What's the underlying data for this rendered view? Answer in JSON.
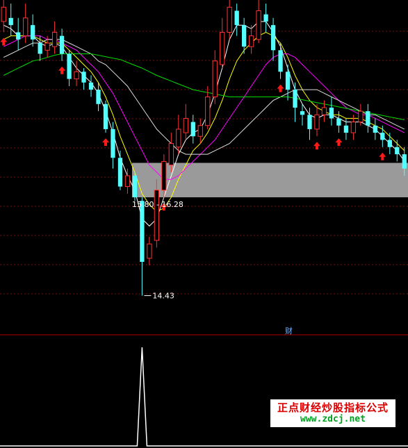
{
  "chart_data": {
    "type": "candlestick",
    "panels": {
      "price": {
        "ylim": [
          14.0,
          18.55
        ],
        "grid": "dotted-horizontal",
        "zone": {
          "low": 15.8,
          "high": 16.28,
          "label": "15.80 - 16.28"
        },
        "low_marker": {
          "value": 14.43,
          "label": "14.43"
        }
      },
      "indicator": {
        "label": "财",
        "ylim": [
          0,
          1
        ],
        "spike_index": 19,
        "spike_value": 1
      }
    },
    "candles": [
      {
        "o": 18.25,
        "c": 18.45,
        "h": 18.6,
        "l": 18.1,
        "up": true
      },
      {
        "o": 18.3,
        "c": 18.2,
        "h": 18.5,
        "l": 18.05,
        "up": false
      },
      {
        "o": 18.1,
        "c": 18.0,
        "h": 18.3,
        "l": 17.85,
        "up": false
      },
      {
        "o": 18.05,
        "c": 18.3,
        "h": 18.5,
        "l": 17.95,
        "up": true
      },
      {
        "o": 18.2,
        "c": 18.0,
        "h": 18.35,
        "l": 17.9,
        "up": false
      },
      {
        "o": 17.95,
        "c": 17.8,
        "h": 18.05,
        "l": 17.7,
        "up": false
      },
      {
        "o": 17.85,
        "c": 17.95,
        "h": 18.05,
        "l": 17.75,
        "up": true
      },
      {
        "o": 17.9,
        "c": 18.1,
        "h": 18.25,
        "l": 17.8,
        "up": true
      },
      {
        "o": 18.05,
        "c": 17.8,
        "h": 18.15,
        "l": 17.7,
        "up": false
      },
      {
        "o": 17.8,
        "c": 17.45,
        "h": 17.85,
        "l": 17.35,
        "up": false
      },
      {
        "o": 17.45,
        "c": 17.55,
        "h": 17.7,
        "l": 17.35,
        "up": true
      },
      {
        "o": 17.55,
        "c": 17.4,
        "h": 17.6,
        "l": 17.3,
        "up": false
      },
      {
        "o": 17.4,
        "c": 17.3,
        "h": 17.5,
        "l": 17.2,
        "up": false
      },
      {
        "o": 17.3,
        "c": 17.1,
        "h": 17.4,
        "l": 17.0,
        "up": false
      },
      {
        "o": 17.1,
        "c": 16.75,
        "h": 17.15,
        "l": 16.7,
        "up": false
      },
      {
        "o": 16.75,
        "c": 16.35,
        "h": 16.85,
        "l": 16.2,
        "up": false
      },
      {
        "o": 16.35,
        "c": 15.95,
        "h": 16.45,
        "l": 15.9,
        "up": false
      },
      {
        "o": 15.95,
        "c": 16.1,
        "h": 16.2,
        "l": 15.85,
        "up": true
      },
      {
        "o": 16.1,
        "c": 15.8,
        "h": 16.15,
        "l": 15.75,
        "up": false
      },
      {
        "o": 15.75,
        "c": 14.9,
        "h": 15.8,
        "l": 14.43,
        "up": false
      },
      {
        "o": 14.95,
        "c": 15.15,
        "h": 15.25,
        "l": 14.85,
        "up": true
      },
      {
        "o": 15.2,
        "c": 15.9,
        "h": 16.05,
        "l": 15.1,
        "up": true
      },
      {
        "o": 15.9,
        "c": 16.3,
        "h": 16.4,
        "l": 15.8,
        "up": true
      },
      {
        "o": 16.25,
        "c": 16.55,
        "h": 16.7,
        "l": 16.15,
        "up": true
      },
      {
        "o": 16.5,
        "c": 16.75,
        "h": 16.95,
        "l": 16.4,
        "up": true
      },
      {
        "o": 16.7,
        "c": 16.9,
        "h": 17.1,
        "l": 16.6,
        "up": true
      },
      {
        "o": 16.85,
        "c": 16.65,
        "h": 16.95,
        "l": 16.55,
        "up": false
      },
      {
        "o": 16.65,
        "c": 16.8,
        "h": 16.9,
        "l": 16.55,
        "up": true
      },
      {
        "o": 16.8,
        "c": 17.2,
        "h": 17.35,
        "l": 16.75,
        "up": true
      },
      {
        "o": 17.2,
        "c": 17.7,
        "h": 17.85,
        "l": 17.1,
        "up": true
      },
      {
        "o": 17.65,
        "c": 18.1,
        "h": 18.3,
        "l": 17.6,
        "up": true
      },
      {
        "o": 18.1,
        "c": 18.45,
        "h": 18.55,
        "l": 18.0,
        "up": true
      },
      {
        "o": 18.4,
        "c": 18.2,
        "h": 18.5,
        "l": 18.05,
        "up": false
      },
      {
        "o": 18.2,
        "c": 17.9,
        "h": 18.3,
        "l": 17.8,
        "up": false
      },
      {
        "o": 17.9,
        "c": 18.05,
        "h": 18.2,
        "l": 17.8,
        "up": true
      },
      {
        "o": 18.0,
        "c": 18.4,
        "h": 18.55,
        "l": 17.95,
        "up": true
      },
      {
        "o": 18.35,
        "c": 18.25,
        "h": 18.5,
        "l": 18.1,
        "up": false
      },
      {
        "o": 18.2,
        "c": 17.85,
        "h": 18.3,
        "l": 17.7,
        "up": false
      },
      {
        "o": 17.85,
        "c": 17.55,
        "h": 17.95,
        "l": 17.45,
        "up": false
      },
      {
        "o": 17.55,
        "c": 17.3,
        "h": 17.65,
        "l": 17.15,
        "up": false
      },
      {
        "o": 17.3,
        "c": 17.05,
        "h": 17.4,
        "l": 16.85,
        "up": false
      },
      {
        "o": 17.0,
        "c": 16.95,
        "h": 17.1,
        "l": 16.8,
        "up": false
      },
      {
        "o": 16.95,
        "c": 16.75,
        "h": 17.05,
        "l": 16.6,
        "up": false
      },
      {
        "o": 16.75,
        "c": 16.95,
        "h": 17.1,
        "l": 16.65,
        "up": true
      },
      {
        "o": 16.95,
        "c": 17.05,
        "h": 17.15,
        "l": 16.85,
        "up": true
      },
      {
        "o": 17.05,
        "c": 16.9,
        "h": 17.2,
        "l": 16.8,
        "up": false
      },
      {
        "o": 16.9,
        "c": 16.8,
        "h": 17.0,
        "l": 16.7,
        "up": false
      },
      {
        "o": 16.8,
        "c": 16.7,
        "h": 16.9,
        "l": 16.6,
        "up": false
      },
      {
        "o": 16.7,
        "c": 16.85,
        "h": 16.95,
        "l": 16.6,
        "up": true
      },
      {
        "o": 16.85,
        "c": 17.0,
        "h": 17.1,
        "l": 16.8,
        "up": true
      },
      {
        "o": 17.0,
        "c": 16.8,
        "h": 17.1,
        "l": 16.7,
        "up": false
      },
      {
        "o": 16.8,
        "c": 16.7,
        "h": 16.9,
        "l": 16.6,
        "up": false
      },
      {
        "o": 16.7,
        "c": 16.6,
        "h": 16.8,
        "l": 16.5,
        "up": false
      },
      {
        "o": 16.6,
        "c": 16.5,
        "h": 16.7,
        "l": 16.4,
        "up": false
      },
      {
        "o": 16.5,
        "c": 16.4,
        "h": 16.6,
        "l": 16.3,
        "up": false
      },
      {
        "o": 16.4,
        "c": 16.2,
        "h": 16.5,
        "l": 16.1,
        "up": false
      }
    ],
    "buy_signals": [
      0,
      8,
      14,
      22,
      38,
      43,
      46,
      52
    ],
    "ma_lines": [
      {
        "color": "#ffffff",
        "values": [
          18.2,
          18.15,
          18.05,
          18.05,
          18.05,
          17.95,
          17.9,
          17.95,
          17.9,
          17.75,
          17.6,
          17.5,
          17.4,
          17.25,
          17.0,
          16.7,
          16.35,
          16.1,
          15.9,
          15.5,
          15.4,
          15.5,
          15.8,
          16.1,
          16.4,
          16.6,
          16.7,
          16.75,
          16.95,
          17.25,
          17.6,
          18.0,
          18.2,
          18.2,
          18.15,
          18.25,
          18.25,
          18.1,
          17.9,
          17.6,
          17.3,
          17.1,
          16.95,
          16.9,
          16.95,
          16.95,
          16.9,
          16.85,
          16.85,
          16.85,
          16.8,
          16.75,
          16.65,
          16.55,
          16.45,
          16.3
        ]
      },
      {
        "color": "#ffff00",
        "values": [
          18.0,
          18.05,
          18.05,
          18.05,
          18.05,
          18.0,
          17.95,
          17.95,
          17.95,
          17.85,
          17.75,
          17.65,
          17.55,
          17.4,
          17.2,
          16.95,
          16.65,
          16.4,
          16.15,
          15.85,
          15.7,
          15.6,
          15.65,
          15.8,
          16.05,
          16.25,
          16.45,
          16.55,
          16.7,
          16.9,
          17.15,
          17.45,
          17.7,
          17.85,
          17.95,
          18.05,
          18.1,
          18.05,
          17.95,
          17.75,
          17.5,
          17.3,
          17.15,
          17.05,
          17.0,
          16.95,
          16.95,
          16.9,
          16.9,
          16.9,
          16.85,
          16.8,
          16.75,
          16.65,
          16.55,
          16.45
        ]
      },
      {
        "color": "#ff00ff",
        "values": [
          17.9,
          17.95,
          18.0,
          18.05,
          18.05,
          18.05,
          18.0,
          18.0,
          17.95,
          17.9,
          17.85,
          17.75,
          17.65,
          17.55,
          17.4,
          17.25,
          17.05,
          16.85,
          16.65,
          16.45,
          16.25,
          16.15,
          16.05,
          16.05,
          16.1,
          16.2,
          16.3,
          16.4,
          16.5,
          16.6,
          16.75,
          16.9,
          17.05,
          17.2,
          17.35,
          17.5,
          17.65,
          17.75,
          17.8,
          17.8,
          17.75,
          17.65,
          17.55,
          17.45,
          17.35,
          17.25,
          17.15,
          17.05,
          17.0,
          16.95,
          16.95,
          16.9,
          16.85,
          16.8,
          16.75,
          16.7
        ]
      },
      {
        "color": "#dcdcdc",
        "values": [
          17.75,
          17.8,
          17.85,
          17.9,
          17.95,
          17.95,
          18.0,
          18.0,
          18.0,
          17.95,
          17.9,
          17.85,
          17.8,
          17.7,
          17.65,
          17.55,
          17.45,
          17.35,
          17.2,
          17.05,
          16.9,
          16.75,
          16.65,
          16.55,
          16.45,
          16.4,
          16.4,
          16.4,
          16.4,
          16.45,
          16.5,
          16.55,
          16.65,
          16.75,
          16.85,
          16.95,
          17.05,
          17.15,
          17.2,
          17.25,
          17.3,
          17.3,
          17.3,
          17.3,
          17.25,
          17.2,
          17.15,
          17.1,
          17.05,
          17.0,
          16.95,
          16.95,
          16.9,
          16.85,
          16.8,
          16.75
        ]
      },
      {
        "color": "#00dd00",
        "values": [
          17.5,
          17.55,
          17.6,
          17.65,
          17.7,
          17.72,
          17.75,
          17.78,
          17.8,
          17.8,
          17.8,
          17.8,
          17.8,
          17.78,
          17.76,
          17.74,
          17.72,
          17.68,
          17.64,
          17.6,
          17.55,
          17.5,
          17.46,
          17.42,
          17.38,
          17.34,
          17.3,
          17.28,
          17.26,
          17.24,
          17.22,
          17.2,
          17.2,
          17.2,
          17.2,
          17.2,
          17.2,
          17.2,
          17.2,
          17.2,
          17.18,
          17.16,
          17.14,
          17.12,
          17.1,
          17.08,
          17.06,
          17.04,
          17.02,
          17.0,
          16.98,
          16.96,
          16.94,
          16.92,
          16.9,
          16.88
        ]
      }
    ]
  },
  "watermark": {
    "cn": "正点财经炒股指标公式",
    "url": "www.zdcj.net"
  }
}
